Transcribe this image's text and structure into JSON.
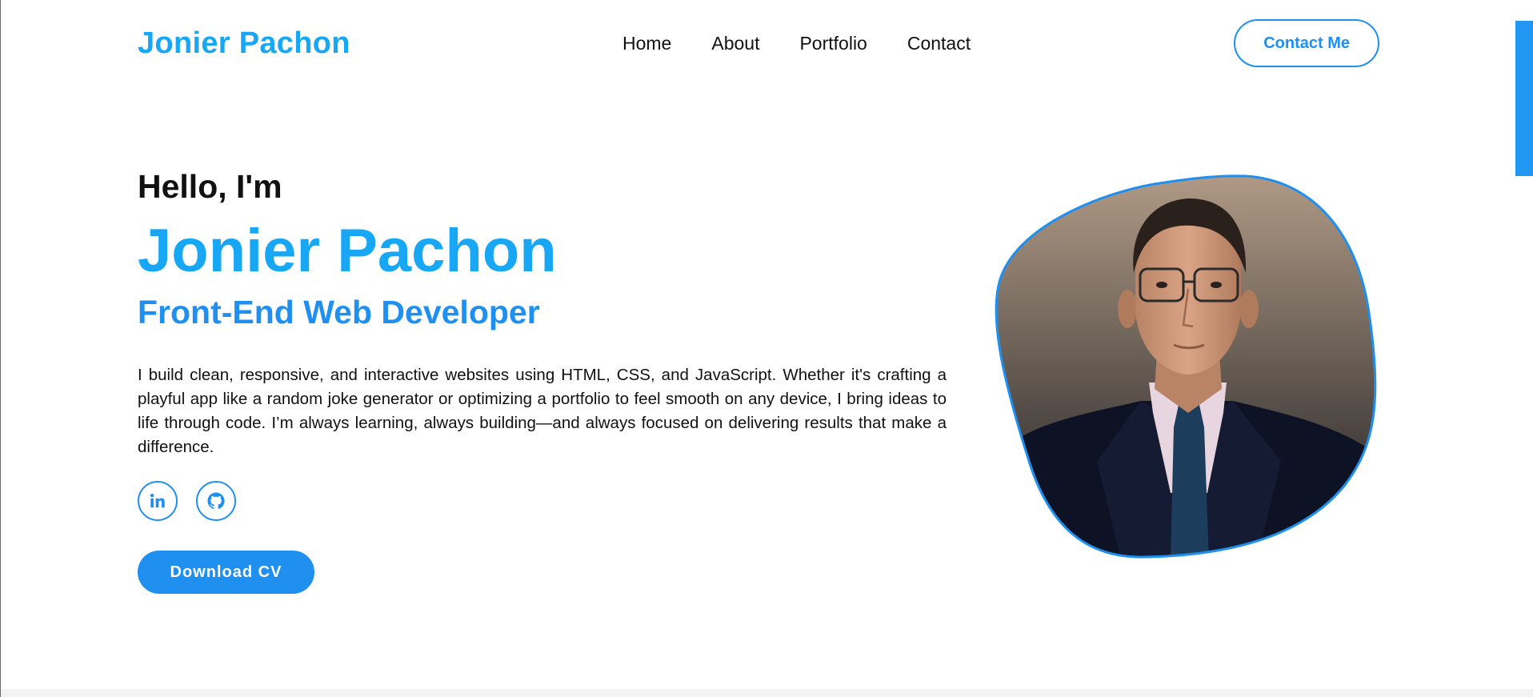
{
  "header": {
    "logo": "Jonier Pachon",
    "nav": [
      "Home",
      "About",
      "Portfolio",
      "Contact"
    ],
    "cta_label": "Contact Me"
  },
  "hero": {
    "greeting": "Hello, I'm",
    "name": "Jonier Pachon",
    "role": "Front-End Web Developer",
    "bio": "I build clean, responsive, and interactive websites using HTML, CSS, and JavaScript. Whether it's crafting a playful app like a random joke generator or optimizing a portfolio to feel smooth on any device, I bring ideas to life through code. I’m always learning, always building—and always focused on delivering results that make a difference.",
    "social_icons": [
      "linkedin-icon",
      "github-icon"
    ],
    "download_label": "Download CV"
  },
  "colors": {
    "accent_light": "#18a7f5",
    "accent": "#1f8ff0",
    "text": "#111111",
    "background": "#ffffff"
  }
}
